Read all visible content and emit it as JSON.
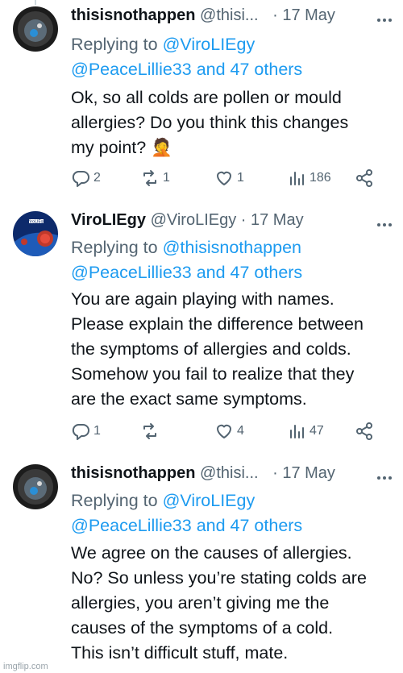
{
  "tweets": [
    {
      "name": "thisisnothappen",
      "handle": "@thisi...",
      "date": "· 17 May",
      "replying_label": "Replying to",
      "mention1": "@ViroLIEgy",
      "mention2": "@PeaceLillie33 and 47 others",
      "text_lines": [
        "Ok, so all colds are pollen or mould",
        "allergies? Do you think this changes",
        "my point? 🤦"
      ],
      "replies": "2",
      "retweets": "1",
      "likes": "1",
      "views": "186"
    },
    {
      "name": "ViroLIEgy",
      "handle": "@ViroLIEgy",
      "date": "· 17 May",
      "avatar_text": "ViroLIEgy",
      "replying_label": "Replying to",
      "mention1": "@thisisnothappen",
      "mention2": "@PeaceLillie33 and 47 others",
      "text_lines": [
        "You are again playing with names.",
        "Please explain the difference between",
        "the symptoms of allergies and colds.",
        "Somehow you fail to realize that they",
        "are the exact same symptoms."
      ],
      "replies": "1",
      "retweets": "",
      "likes": "4",
      "views": "47"
    },
    {
      "name": "thisisnothappen",
      "handle": "@thisi...",
      "date": "· 17 May",
      "replying_label": "Replying to",
      "mention1": "@ViroLIEgy",
      "mention2": "@PeaceLillie33 and 47 others",
      "text_lines": [
        "We agree on the causes of allergies.",
        "No? So unless you’re stating colds are",
        "allergies, you aren’t giving me the",
        "causes of the symptoms of a cold.",
        "This isn’t difficult stuff, mate."
      ]
    }
  ],
  "watermark": "imgflip.com",
  "colors": {
    "link": "#1d9bf0",
    "secondary": "#536471",
    "text": "#0f1419"
  }
}
